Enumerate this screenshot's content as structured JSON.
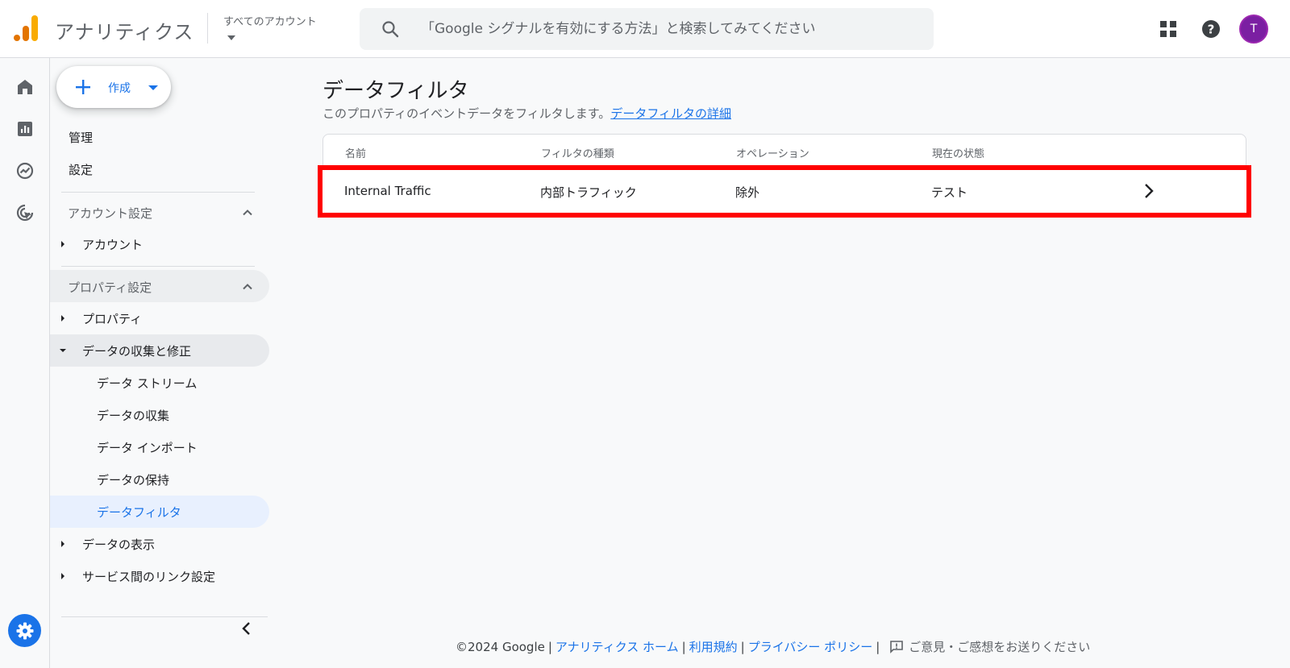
{
  "header": {
    "app_name": "アナリティクス",
    "account_label": "すべてのアカウント",
    "search_placeholder": "「Google シグナルを有効にする方法」と検索してみてください",
    "avatar_letter": "T",
    "logo_colors": [
      "#e37400",
      "#f9ab00"
    ],
    "avatar_color": "#7b1fa2"
  },
  "rail": {
    "icons": [
      "home-icon",
      "reports-icon",
      "explore-icon",
      "advertising-icon"
    ],
    "admin_icon": "gear-icon"
  },
  "sidenav": {
    "create_label": "作成",
    "admin": "管理",
    "settings": "設定",
    "account_section": "アカウント設定",
    "account_item": "アカウント",
    "property_section": "プロパティ設定",
    "property_item": "プロパティ",
    "data_collection": "データの収集と修正",
    "sub_items": {
      "streams": "データ ストリーム",
      "collection": "データの収集",
      "import": "データ インポート",
      "retention": "データの保持",
      "filters": "データフィルタ"
    },
    "data_display": "データの表示",
    "product_links": "サービス間のリンク設定"
  },
  "main": {
    "title": "データフィルタ",
    "description": "このプロパティのイベントデータをフィルタします。",
    "learn_more": "データフィルタの詳細",
    "columns": [
      "名前",
      "フィルタの種類",
      "オペレーション",
      "現在の状態"
    ],
    "rows": [
      {
        "name": "Internal Traffic",
        "type": "内部トラフィック",
        "operation": "除外",
        "state": "テスト"
      }
    ],
    "highlight_color": "#ff0000"
  },
  "footer": {
    "copyright": "©2024 Google",
    "home": "アナリティクス ホーム",
    "terms": "利用規約",
    "privacy": "プライバシー ポリシー",
    "feedback": "ご意見・ご感想をお送りください",
    "separator": "|"
  }
}
